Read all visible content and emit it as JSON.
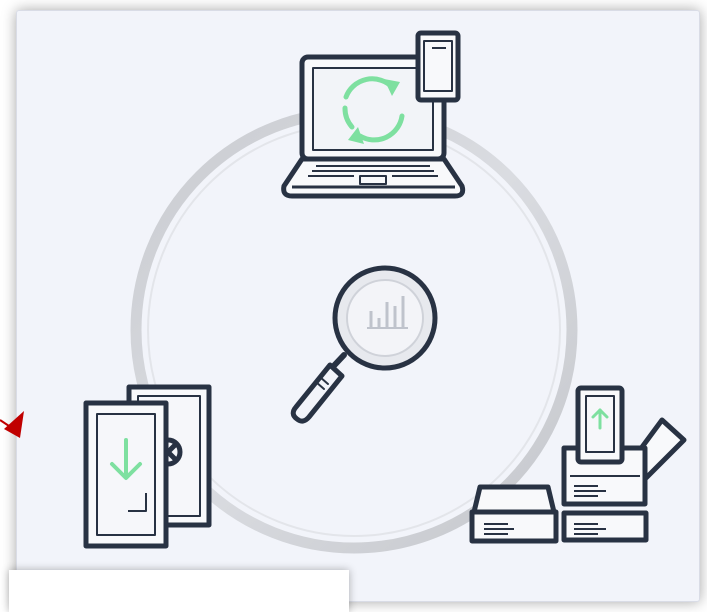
{
  "colors": {
    "panel": "#f2f4fa",
    "ring": "#cfd1d6",
    "outline": "#283243",
    "accent": "#7ee0a0",
    "magnifier_glass": "#e6e8ef",
    "pointer_arrow": "#c00000"
  },
  "icons": {
    "center": "magnifier-chart-icon",
    "top": "laptop-phone-sync-icon",
    "left": "documents-download-icon",
    "right": "devices-upload-icon",
    "pointer": "red-arrow-icon"
  }
}
